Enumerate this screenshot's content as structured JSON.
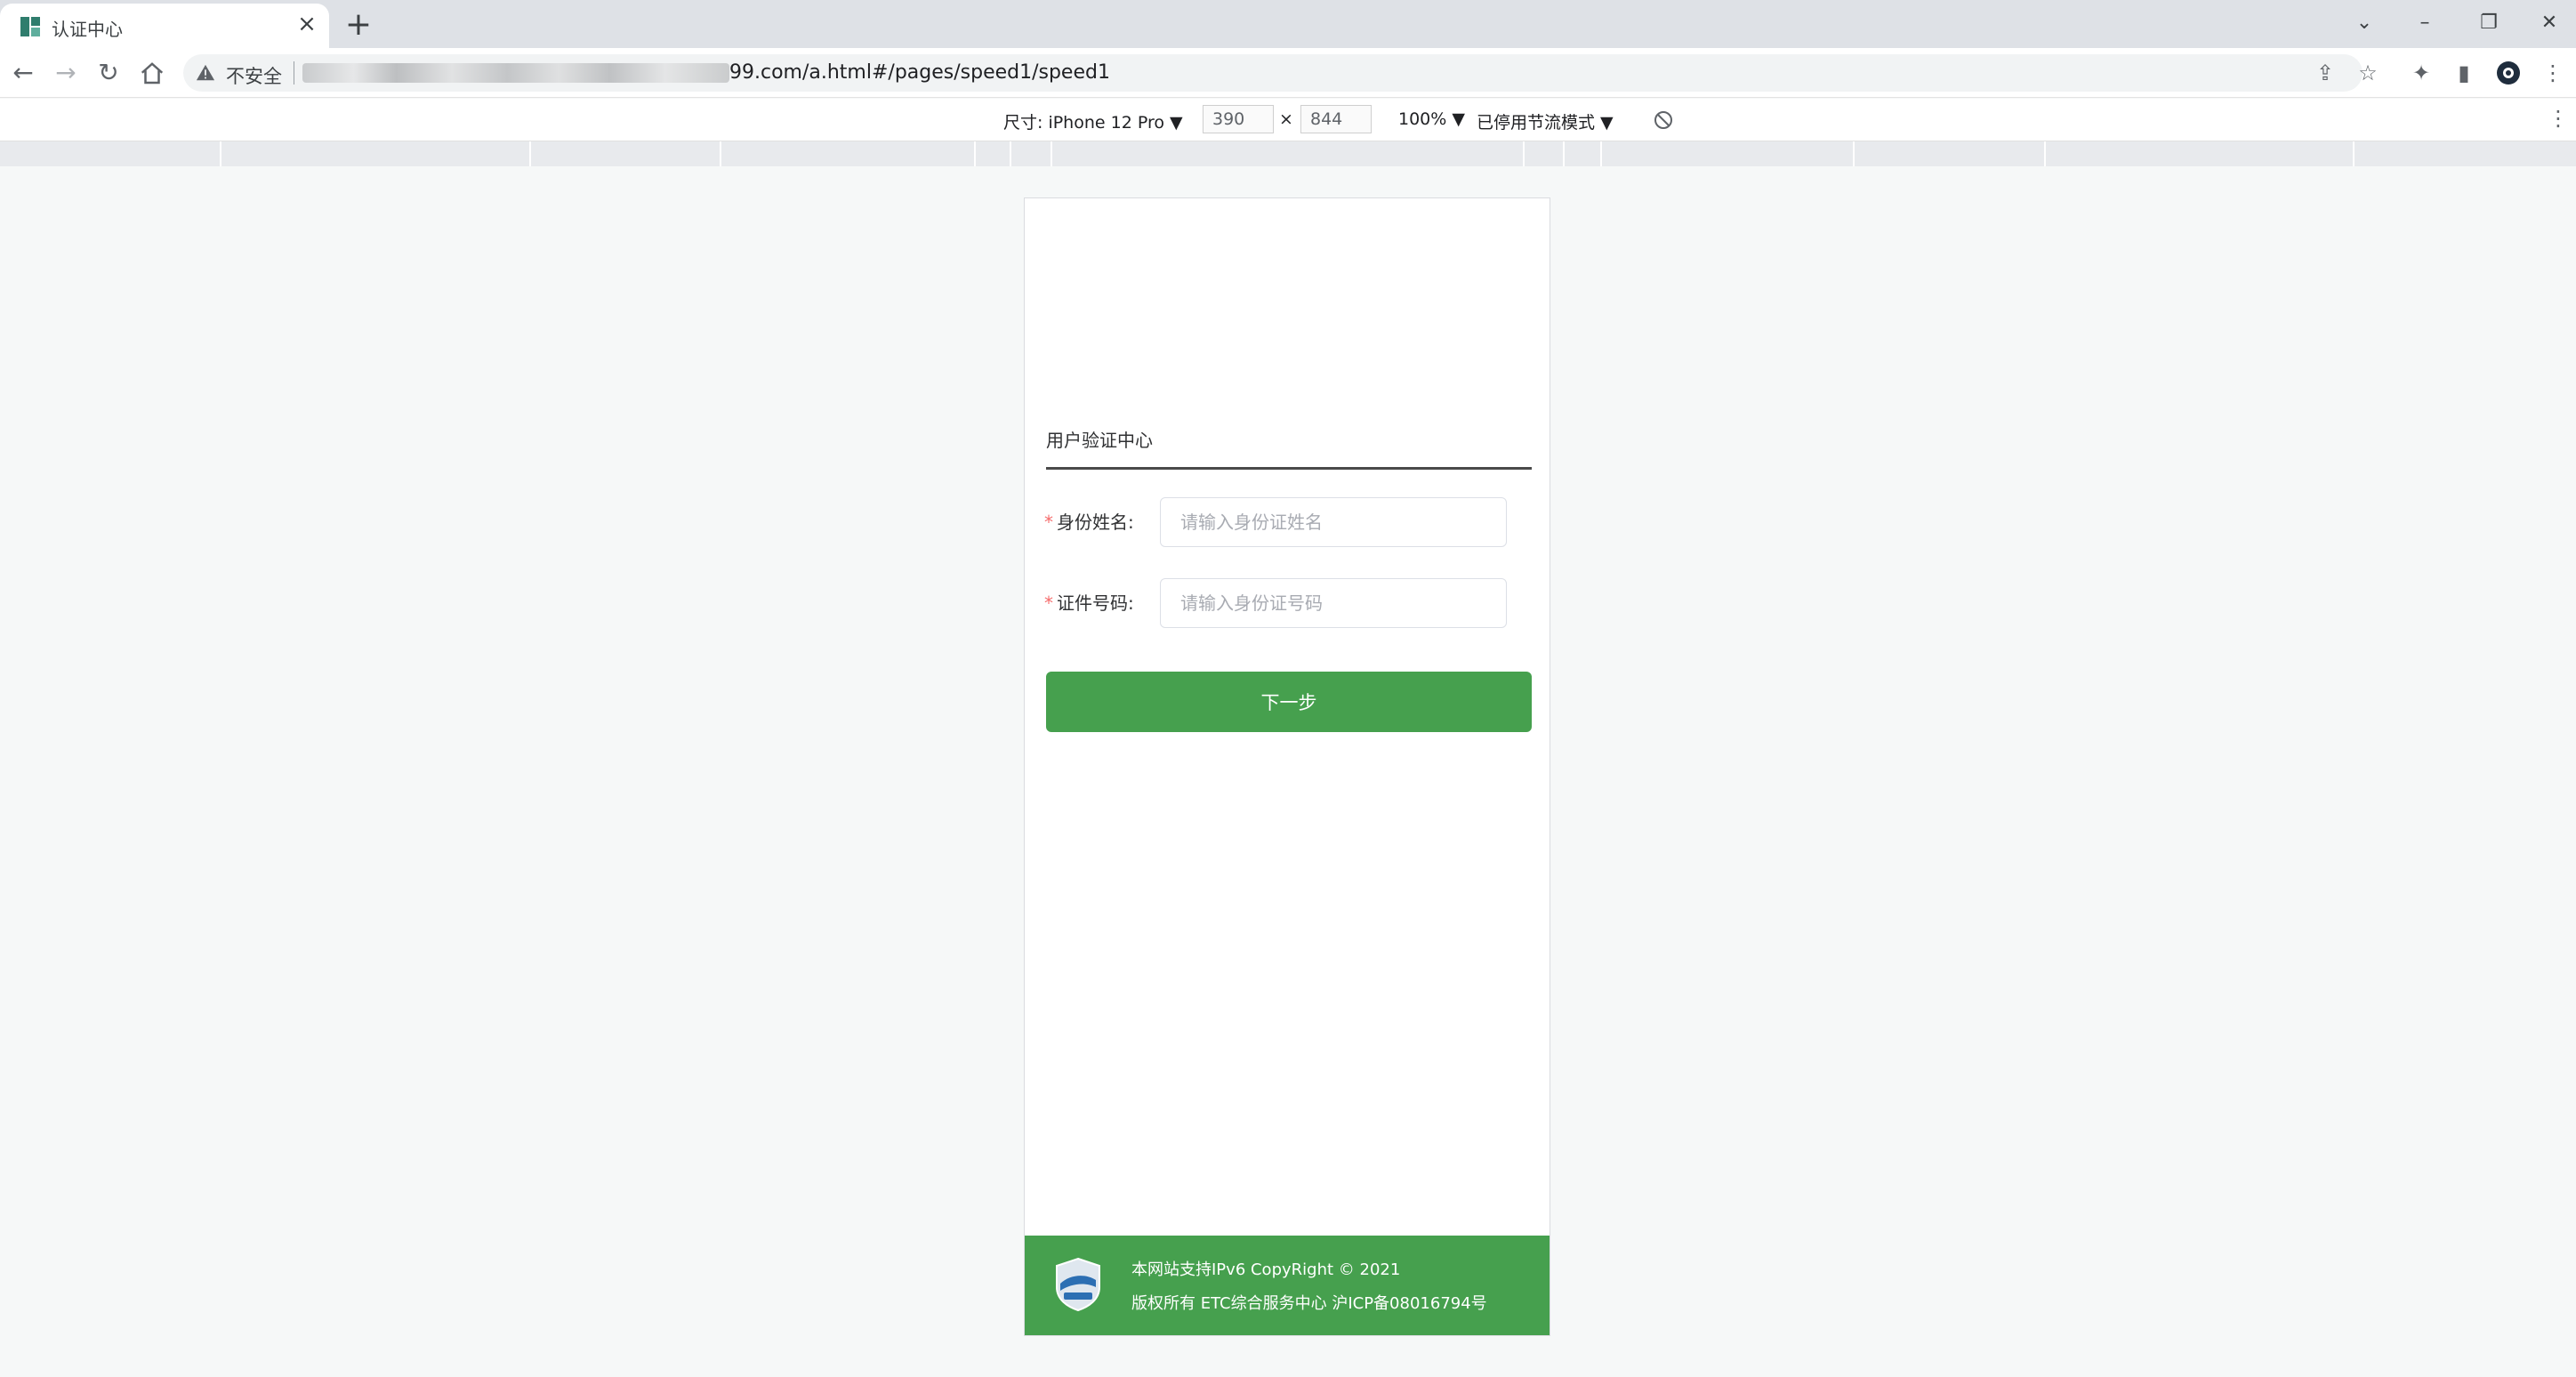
{
  "browser": {
    "tab_title": "认证中心",
    "new_tab": "+",
    "security_label": "不安全",
    "url_visible": "99.com/a.html#/pages/speed1/speed1"
  },
  "devtools": {
    "dimensions_label": "尺寸: iPhone 12 Pro ▼",
    "width": "390",
    "times": "×",
    "height": "844",
    "zoom": "100% ▼",
    "throttling": "已停用节流模式 ▼"
  },
  "page": {
    "form_title": "用户验证中心",
    "required_mark": "*",
    "name_label": "身份姓名:",
    "name_placeholder": "请输入身份证姓名",
    "id_label": "证件号码:",
    "id_placeholder": "请输入身份证号码",
    "next_button": "下一步",
    "footer_line1": "本网站支持IPv6 CopyRight © 2021",
    "footer_line2": "版权所有 ETC综合服务中心 沪ICP备08016794号"
  },
  "colors": {
    "accent_green": "#46a04e",
    "required_red": "#f56c6c"
  }
}
